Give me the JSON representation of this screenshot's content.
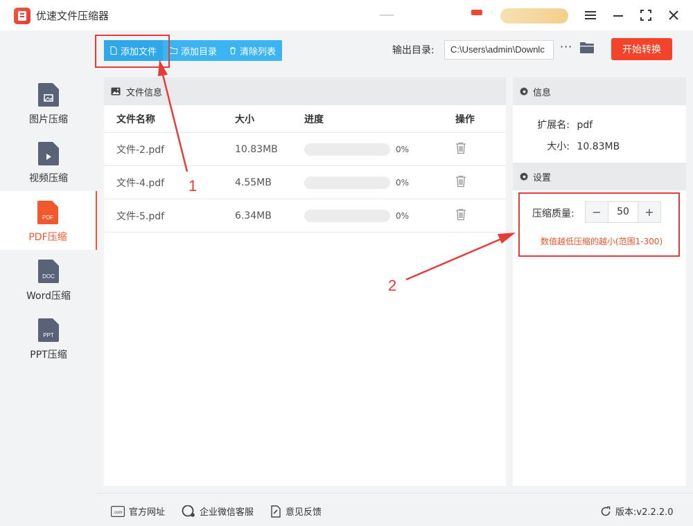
{
  "app": {
    "title": "优速文件压缩器",
    "accent": "#f1582e",
    "primary_blue": "#3bb4f2",
    "window_controls": [
      "menu-icon",
      "minimize-icon",
      "maximize-icon",
      "close-icon"
    ]
  },
  "sidebar": {
    "items": [
      {
        "label": "图片压缩",
        "icon": "image-file-icon",
        "tag": "",
        "active": false
      },
      {
        "label": "视频压缩",
        "icon": "video-file-icon",
        "tag": "",
        "active": false
      },
      {
        "label": "PDF压缩",
        "icon": "pdf-file-icon",
        "tag": "PDF",
        "active": true
      },
      {
        "label": "Word压缩",
        "icon": "doc-file-icon",
        "tag": "DOC",
        "active": false
      },
      {
        "label": "PPT压缩",
        "icon": "ppt-file-icon",
        "tag": "PPT",
        "active": false
      }
    ]
  },
  "toolbar": {
    "add_file": "添加文件",
    "add_folder": "添加目录",
    "clear_list": "清除列表",
    "output_label": "输出目录:",
    "output_path": "C:\\Users\\admin\\Downlc",
    "more": "···",
    "start": "开始转换"
  },
  "file_panel": {
    "title": "文件信息",
    "columns": [
      "文件名称",
      "大小",
      "进度",
      "操作"
    ],
    "rows": [
      {
        "name": "文件-2.pdf",
        "size": "10.83MB",
        "progress": "0%",
        "progress_value": 0
      },
      {
        "name": "文件-4.pdf",
        "size": "4.55MB",
        "progress": "0%",
        "progress_value": 0
      },
      {
        "name": "文件-5.pdf",
        "size": "6.34MB",
        "progress": "0%",
        "progress_value": 0
      }
    ]
  },
  "info_panel": {
    "title": "信息",
    "ext_label": "扩展名:",
    "ext_value": "pdf",
    "size_label": "大小:",
    "size_value": "10.83MB"
  },
  "settings_panel": {
    "title": "设置",
    "quality_label": "压缩质量:",
    "quality_value": "50",
    "minus": "−",
    "plus": "+",
    "hint": "数值越低压缩的越小(范围1-300)"
  },
  "footer": {
    "website": "官方网址",
    "wechat": "企业微信客服",
    "feedback": "意见反馈",
    "version": "版本:v2.2.2.0",
    "website_badge": ".com"
  },
  "annotations": {
    "label_1": "1",
    "label_2": "2",
    "color": "#e53b3b"
  }
}
